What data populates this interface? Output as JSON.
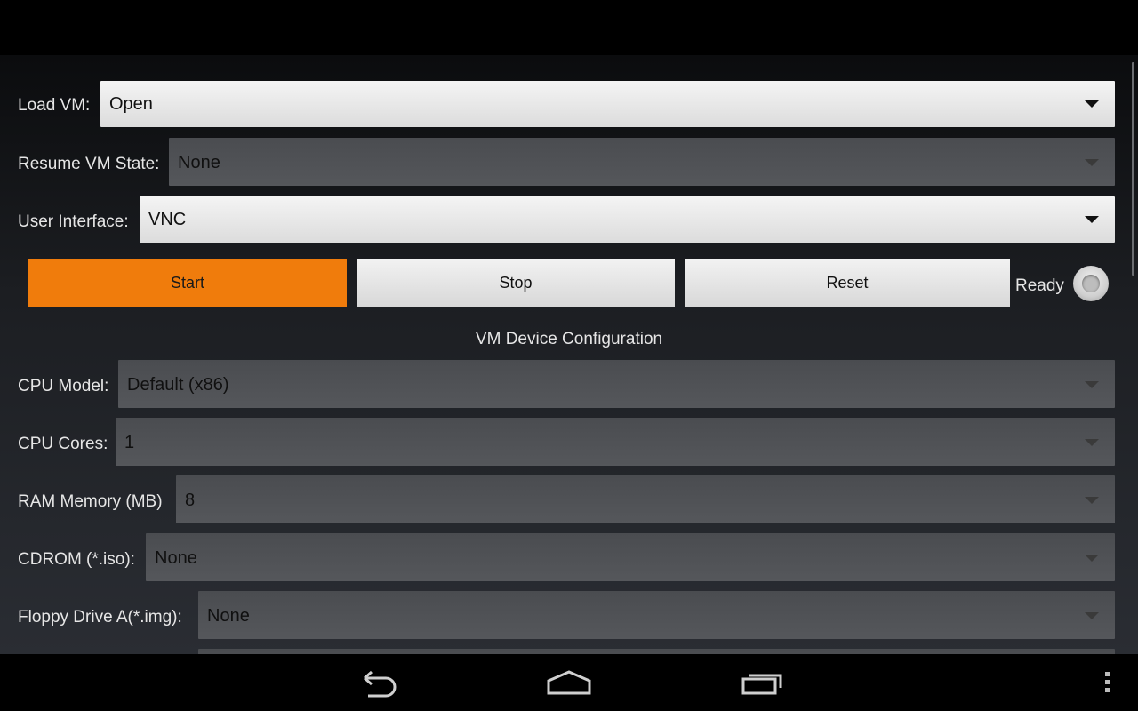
{
  "form": {
    "load_vm": {
      "label": "Load VM:",
      "value": "Open"
    },
    "resume_state": {
      "label": "Resume VM State:",
      "value": "None"
    },
    "user_interface": {
      "label": "User Interface:",
      "value": "VNC"
    }
  },
  "controls": {
    "start_label": "Start",
    "stop_label": "Stop",
    "reset_label": "Reset",
    "status_label": "Ready"
  },
  "device_config": {
    "title": "VM Device Configuration",
    "cpu_model": {
      "label": "CPU Model:",
      "value": "Default (x86)"
    },
    "cpu_cores": {
      "label": "CPU Cores:",
      "value": "1"
    },
    "ram": {
      "label": "RAM Memory (MB)",
      "value": "8"
    },
    "cdrom": {
      "label": "CDROM (*.iso):",
      "value": "None"
    },
    "floppy_a": {
      "label": "Floppy Drive A(*.img):",
      "value": "None"
    }
  },
  "nav": {
    "back_icon": "back-arrow-icon",
    "home_icon": "home-icon",
    "recents_icon": "recent-apps-icon",
    "menu_icon": "overflow-menu-icon"
  },
  "colors": {
    "accent": "#f07c0c",
    "background": "#000000"
  }
}
